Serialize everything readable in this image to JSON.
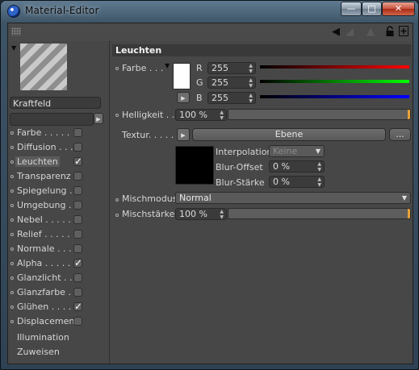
{
  "window": {
    "title": "Material-Editor",
    "btn_min": "—",
    "btn_max": "□",
    "btn_close": "✕"
  },
  "toolbar": {
    "icons": [
      "back-arrow",
      "forward-arrow",
      "up-arrow",
      "lock",
      "new-window"
    ]
  },
  "material": {
    "name": "Kraftfeld"
  },
  "channels": [
    {
      "label": "Farbe . . . . . .",
      "checked": false
    },
    {
      "label": "Diffusion . . . .",
      "checked": false
    },
    {
      "label": "Leuchten",
      "checked": true,
      "active": true
    },
    {
      "label": "Transparenz",
      "checked": false
    },
    {
      "label": "Spiegelung . .",
      "checked": false
    },
    {
      "label": "Umgebung . .",
      "checked": false
    },
    {
      "label": "Nebel . . . . . .",
      "checked": false
    },
    {
      "label": "Relief . . . . . .",
      "checked": false
    },
    {
      "label": "Normale . . . .",
      "checked": false
    },
    {
      "label": "Alpha . . . . . .",
      "checked": true
    },
    {
      "label": "Glanzlicht . . .",
      "checked": false
    },
    {
      "label": "Glanzfarbe . .",
      "checked": false
    },
    {
      "label": "Glühen . . . . .",
      "checked": true
    },
    {
      "label": "Displacement",
      "checked": false
    }
  ],
  "extra_items": [
    "Illumination",
    "Zuweisen"
  ],
  "section": {
    "title": "Leuchten"
  },
  "color": {
    "label": "Farbe . . .",
    "swatch": "#ffffff",
    "r_label": "R",
    "r_value": "255",
    "g_label": "G",
    "g_value": "255",
    "b_label": "B",
    "b_value": "255"
  },
  "brightness": {
    "label": "Helligkeit . .",
    "value": "100 %",
    "fraction": 1.0
  },
  "texture": {
    "label": "Textur. . . . . .",
    "layer_button": "Ebene",
    "more_button": "...",
    "interpolation_label": "Interpolation",
    "interpolation_value": "Keine",
    "blur_offset_label": "Blur-Offset",
    "blur_offset_value": "0 %",
    "blur_strength_label": "Blur-Stärke",
    "blur_strength_value": "0 %"
  },
  "mix_mode": {
    "label": "Mischmodus",
    "value": "Normal"
  },
  "mix_strength": {
    "label": "Mischstärke",
    "value": "100 %",
    "fraction": 1.0
  }
}
